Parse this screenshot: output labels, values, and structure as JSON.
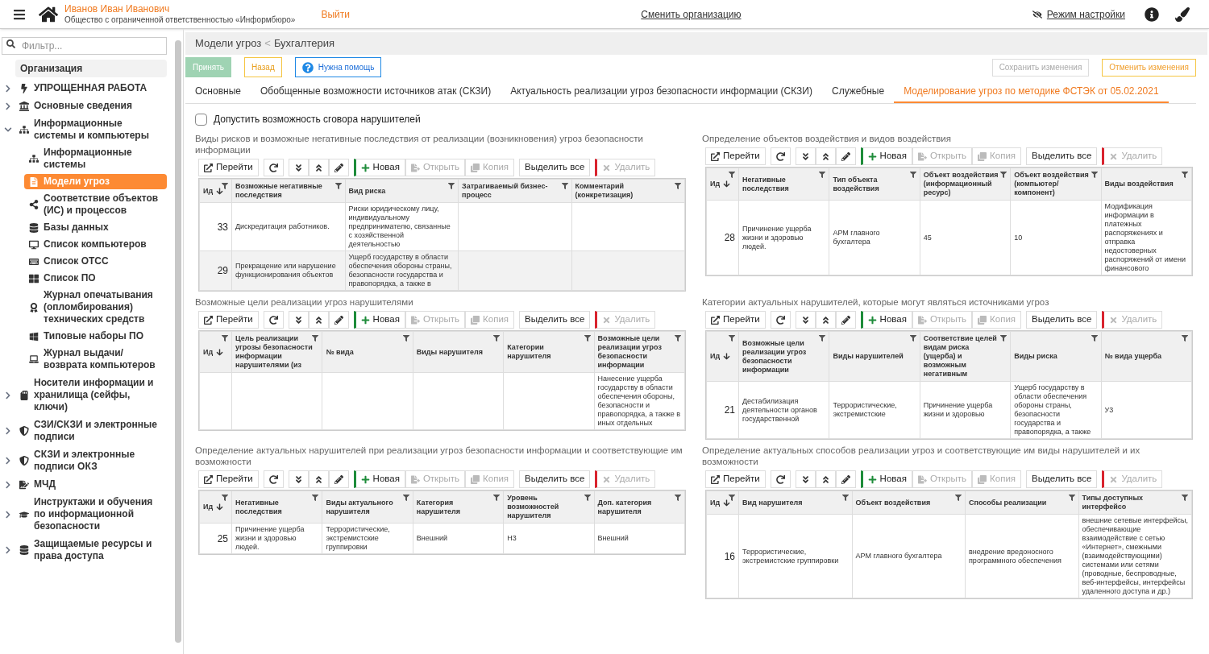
{
  "header": {
    "user_name": "Иванов Иван Иванович",
    "organization": "Общество с ограниченной ответственностью «Информбюро»",
    "logout": "Выйти",
    "change_org": "Сменить организацию",
    "settings_mode": "Режим настройки"
  },
  "sidebar": {
    "filter_placeholder": "Фильтр...",
    "root": "Организация",
    "items": [
      {
        "label": "УПРОЩЕННАЯ РАБОТА",
        "expanded": false,
        "selected": false
      },
      {
        "label": "Основные сведения",
        "expanded": false,
        "selected": false
      },
      {
        "label": "Информационные системы и компьютеры",
        "expanded": true,
        "selected": false,
        "children": [
          {
            "label": "Информационные системы",
            "selected": false
          },
          {
            "label": "Модели угроз",
            "selected": true
          },
          {
            "label": "Соответствие объектов (ИС) и процессов",
            "selected": false
          },
          {
            "label": "Базы данных",
            "selected": false
          },
          {
            "label": "Список компьютеров",
            "selected": false
          },
          {
            "label": "Список ОТСС",
            "selected": false
          },
          {
            "label": "Список ПО",
            "selected": false
          },
          {
            "label": "Журнал опечатывания (опломбирования) технических средств",
            "selected": false
          },
          {
            "label": "Типовые наборы ПО",
            "selected": false
          },
          {
            "label": "Журнал выдачи/ возврата компьютеров",
            "selected": false
          }
        ]
      },
      {
        "label": "Носители информации и хранилища (сейфы, ключи)",
        "expanded": false,
        "selected": false
      },
      {
        "label": "СЗИ/СКЗИ и электронные подписи",
        "expanded": false,
        "selected": false
      },
      {
        "label": "СКЗИ и электронные подписи ОКЗ",
        "expanded": false,
        "selected": false
      },
      {
        "label": "МЧД",
        "expanded": false,
        "selected": false
      },
      {
        "label": "Инструктажи и обучения по информационной безопасности",
        "expanded": false,
        "selected": false
      },
      {
        "label": "Защищаемые ресурсы и права доступа",
        "expanded": false,
        "selected": false
      }
    ]
  },
  "breadcrumb": {
    "parent": "Модели угроз",
    "separator": "<",
    "current": "Бухгалтерия"
  },
  "actions": [
    {
      "kind": "accept",
      "label": "Принять",
      "disabled": true
    },
    {
      "kind": "back",
      "label": "Назад",
      "disabled": false
    },
    {
      "kind": "help",
      "label": "Нужна помощь",
      "disabled": false
    }
  ],
  "actions_right": [
    {
      "kind": "save",
      "label": "Сохранить изменения",
      "disabled": true
    },
    {
      "kind": "cancel",
      "label": "Отменить изменения",
      "disabled": false
    }
  ],
  "tabs": [
    {
      "label": "Основные",
      "selected": false
    },
    {
      "label": "Обобщенные возможности источников атак (СКЗИ)",
      "selected": false
    },
    {
      "label": "Актуальность реализации угроз безопасности информации (СКЗИ)",
      "selected": false
    },
    {
      "label": "Служебные",
      "selected": false
    },
    {
      "label": "Моделирование угроз по методике ФСТЭК от 05.02.2021",
      "selected": true
    }
  ],
  "collusion": {
    "label": "Допустить возможность сговора нарушителей",
    "checked": false
  },
  "grids": [
    {
      "title": "Виды рисков и возможные негативные последствия от реализации (возникновения) угроз безопасности информации",
      "toolbar": [
        {
          "kind": "goto",
          "label": "Перейти",
          "disabled": false
        },
        {
          "kind": "refresh",
          "disabled": false
        },
        {
          "kind": "expand",
          "disabled": false
        },
        {
          "kind": "collapse",
          "disabled": false
        },
        {
          "kind": "edit",
          "disabled": false
        },
        {
          "kind": "new",
          "label": "Новая",
          "disabled": false
        },
        {
          "kind": "open",
          "label": "Открыть",
          "disabled": true
        },
        {
          "kind": "copy",
          "label": "Копия",
          "disabled": true
        },
        {
          "kind": "select_all",
          "label": "Выделить все",
          "disabled": false
        },
        {
          "kind": "delete",
          "label": "Удалить",
          "disabled": true
        }
      ],
      "columns": [
        {
          "label": "Ид",
          "sorted": true
        },
        {
          "label": "Возможные негативные последствия",
          "sorted": false
        },
        {
          "label": "Вид риска",
          "sorted": false
        },
        {
          "label": "Затрагиваемый бизнес-процесс",
          "sorted": false
        },
        {
          "label": "Комментарий (конкретизация)",
          "sorted": false
        }
      ],
      "rows": [
        {
          "cells": [
            "33",
            "Дискредитация работников.",
            "Риски юридическому лицу, индивидуальному предпринимателю, связанные с хозяйственной деятельностью",
            null,
            null
          ]
        },
        {
          "cells": [
            "29",
            "Прекращение или нарушение функционирования объектов",
            "Ущерб государству в области обеспечения обороны страны, безопасности государства и правопорядка, а также в",
            null,
            null
          ]
        }
      ]
    },
    {
      "title": "Определение объектов воздействия и видов воздействия",
      "toolbar": [
        {
          "kind": "goto",
          "label": "Перейти",
          "disabled": false
        },
        {
          "kind": "refresh",
          "disabled": false
        },
        {
          "kind": "expand",
          "disabled": false
        },
        {
          "kind": "collapse",
          "disabled": false
        },
        {
          "kind": "edit",
          "disabled": false
        },
        {
          "kind": "new",
          "label": "Новая",
          "disabled": false
        },
        {
          "kind": "open",
          "label": "Открыть",
          "disabled": true
        },
        {
          "kind": "copy",
          "label": "Копия",
          "disabled": true
        },
        {
          "kind": "select_all",
          "label": "Выделить все",
          "disabled": false
        },
        {
          "kind": "delete",
          "label": "Удалить",
          "disabled": true
        }
      ],
      "columns": [
        {
          "label": "Ид",
          "sorted": true
        },
        {
          "label": "Негативные последствия",
          "sorted": false
        },
        {
          "label": "Тип объекта воздействия",
          "sorted": false
        },
        {
          "label": "Объект воздействия (информационный ресурс)",
          "sorted": false
        },
        {
          "label": "Объект воздействия (компьютер/компонент)",
          "sorted": false
        },
        {
          "label": "Виды воздействия",
          "sorted": false
        }
      ],
      "rows": [
        {
          "cells": [
            "28",
            "Причинение ущерба жизни и здоровью людей.",
            "АРМ главного бухгалтера",
            "45",
            "10",
            "Модификация информации в платежных распоряжениях и отправка недостоверных распоряжений от имени финансового"
          ]
        }
      ]
    },
    {
      "title": "Возможные цели реализации угроз нарушителями",
      "toolbar": [
        {
          "kind": "goto",
          "label": "Перейти",
          "disabled": false
        },
        {
          "kind": "refresh",
          "disabled": false
        },
        {
          "kind": "expand",
          "disabled": false
        },
        {
          "kind": "collapse",
          "disabled": false
        },
        {
          "kind": "edit",
          "disabled": false
        },
        {
          "kind": "new",
          "label": "Новая",
          "disabled": false
        },
        {
          "kind": "open",
          "label": "Открыть",
          "disabled": true
        },
        {
          "kind": "copy",
          "label": "Копия",
          "disabled": true
        },
        {
          "kind": "select_all",
          "label": "Выделить все",
          "disabled": false
        },
        {
          "kind": "delete",
          "label": "Удалить",
          "disabled": true
        }
      ],
      "columns": [
        {
          "label": "Ид",
          "sorted": true
        },
        {
          "label": "Цель реализации угрозы безопасности информации нарушителями (из",
          "sorted": false
        },
        {
          "label": "№ вида",
          "sorted": false
        },
        {
          "label": "Виды нарушителя",
          "sorted": false
        },
        {
          "label": "Категории нарушителя",
          "sorted": false
        },
        {
          "label": "Возможные цели реализации угроз безопасности информации",
          "sorted": false
        }
      ],
      "rows": [
        {
          "cells": [
            null,
            null,
            null,
            null,
            null,
            "Нанесение ущерба государству в области обеспечения обороны, безопасности и правопорядка, а также в иных отдельных"
          ]
        }
      ]
    },
    {
      "title": "Категории актуальных нарушителей, которые могут являться источниками угроз",
      "toolbar": [
        {
          "kind": "goto",
          "label": "Перейти",
          "disabled": false
        },
        {
          "kind": "refresh",
          "disabled": false
        },
        {
          "kind": "expand",
          "disabled": false
        },
        {
          "kind": "collapse",
          "disabled": false
        },
        {
          "kind": "edit",
          "disabled": false
        },
        {
          "kind": "new",
          "label": "Новая",
          "disabled": false
        },
        {
          "kind": "open",
          "label": "Открыть",
          "disabled": true
        },
        {
          "kind": "copy",
          "label": "Копия",
          "disabled": true
        },
        {
          "kind": "select_all",
          "label": "Выделить все",
          "disabled": false
        },
        {
          "kind": "delete",
          "label": "Удалить",
          "disabled": true
        }
      ],
      "columns": [
        {
          "label": "Ид",
          "sorted": true
        },
        {
          "label": "Возможные цели реализации угроз безопасности информации",
          "sorted": false
        },
        {
          "label": "Виды нарушителей",
          "sorted": false
        },
        {
          "label": "Соответствие целей видам риска (ущерба) и возможным негативным",
          "sorted": false
        },
        {
          "label": "Виды риска",
          "sorted": false
        },
        {
          "label": "№ вида ущерба",
          "sorted": false
        }
      ],
      "rows": [
        {
          "cells": [
            "21",
            "Дестабилизация деятельности органов государственной",
            "Террористические, экстремистские",
            "Причинение ущерба жизни и здоровью",
            "Ущерб государству в области обеспечения обороны страны, безопасности государства и правопорядка, а также",
            "У3"
          ]
        }
      ]
    },
    {
      "title": "Определение актуальных нарушителей при реализации угроз безопасности информации и соответствующие им возможности",
      "toolbar": [
        {
          "kind": "goto",
          "label": "Перейти",
          "disabled": false
        },
        {
          "kind": "refresh",
          "disabled": false
        },
        {
          "kind": "expand",
          "disabled": false
        },
        {
          "kind": "collapse",
          "disabled": false
        },
        {
          "kind": "edit",
          "disabled": false
        },
        {
          "kind": "new",
          "label": "Новая",
          "disabled": false
        },
        {
          "kind": "open",
          "label": "Открыть",
          "disabled": true
        },
        {
          "kind": "copy",
          "label": "Копия",
          "disabled": true
        },
        {
          "kind": "select_all",
          "label": "Выделить все",
          "disabled": false
        },
        {
          "kind": "delete",
          "label": "Удалить",
          "disabled": true
        }
      ],
      "columns": [
        {
          "label": "Ид",
          "sorted": true
        },
        {
          "label": "Негативные последствия",
          "sorted": false
        },
        {
          "label": "Виды актуального нарушителя",
          "sorted": false
        },
        {
          "label": "Категория нарушителя",
          "sorted": false
        },
        {
          "label": "Уровень возможностей нарушителя",
          "sorted": false
        },
        {
          "label": "Доп. категория нарушителя",
          "sorted": false
        }
      ],
      "rows": [
        {
          "cells": [
            "25",
            "Причинение ущерба жизни и здоровью людей.",
            "Террористические, экстремистские группировки",
            "Внешний",
            "Н3",
            "Внешний"
          ]
        }
      ]
    },
    {
      "title": "Определение актуальных способов реализации угроз и соответствующие им виды нарушителей и их возможности",
      "toolbar": [
        {
          "kind": "goto",
          "label": "Перейти",
          "disabled": false
        },
        {
          "kind": "refresh",
          "disabled": false
        },
        {
          "kind": "expand",
          "disabled": false
        },
        {
          "kind": "collapse",
          "disabled": false
        },
        {
          "kind": "edit",
          "disabled": false
        },
        {
          "kind": "new",
          "label": "Новая",
          "disabled": false
        },
        {
          "kind": "open",
          "label": "Открыть",
          "disabled": true
        },
        {
          "kind": "copy",
          "label": "Копия",
          "disabled": true
        },
        {
          "kind": "select_all",
          "label": "Выделить все",
          "disabled": false
        },
        {
          "kind": "delete",
          "label": "Удалить",
          "disabled": true
        }
      ],
      "columns": [
        {
          "label": "Ид",
          "sorted": true
        },
        {
          "label": "Вид нарушителя",
          "sorted": false
        },
        {
          "label": "Объект воздействия",
          "sorted": false
        },
        {
          "label": "Способы реализации",
          "sorted": false
        },
        {
          "label": "Типы доступных интерфейсо",
          "sorted": false
        }
      ],
      "rows": [
        {
          "cells": [
            "16",
            "Террористические, экстремистские группировки",
            "АРМ главного бухгалтера",
            "внедрение вредоносного программного обеспечения",
            "внешние сетевые интерфейсы, обеспечивающие взаимодействие с сетью «Интернет», смежными (взаимодействующими) системами или сетями (проводные, беспроводные, веб-интерфейсы, интерфейсы удаленного доступа и др.)"
          ]
        }
      ]
    }
  ]
}
